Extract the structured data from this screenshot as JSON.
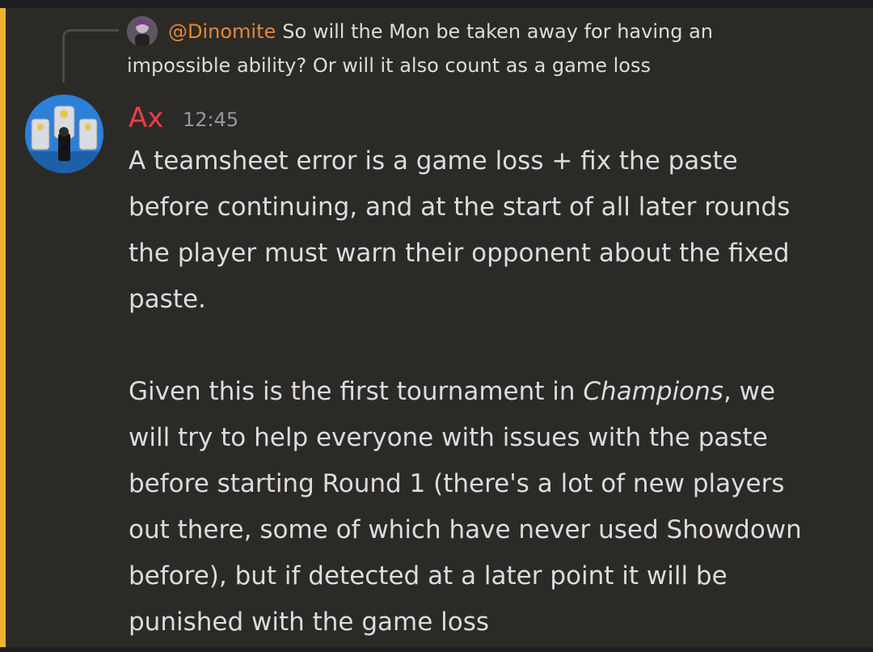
{
  "reply": {
    "author": "@Dinomite",
    "text": "So will the Mon be taken away for having an impossible ability? Or will it also count as a game loss"
  },
  "message": {
    "author": "Ax",
    "time": "12:45",
    "paragraph1_lines": [
      "A teamsheet error is a game loss + fix the paste",
      "before continuing, and at the start of all later rounds",
      "the player must warn their opponent about the fixed",
      "paste."
    ],
    "paragraph2": {
      "line1_before": "Given this is the first tournament in ",
      "line1_italic": "Champions",
      "line1_after": ", we",
      "lines": [
        "will try to help everyone with issues with the paste",
        "before starting Round 1 (there's a lot of new players",
        "out there, some of which have never used Showdown",
        "before), but if detected at a later point it will be",
        "punished with the game loss"
      ]
    }
  },
  "colors": {
    "background": "#2c2a27",
    "mention_bar": "#f0b232",
    "author_color": "#ea3f46",
    "reply_author_color": "#e0883a",
    "text": "#dbdce0",
    "timestamp": "#96979d"
  }
}
